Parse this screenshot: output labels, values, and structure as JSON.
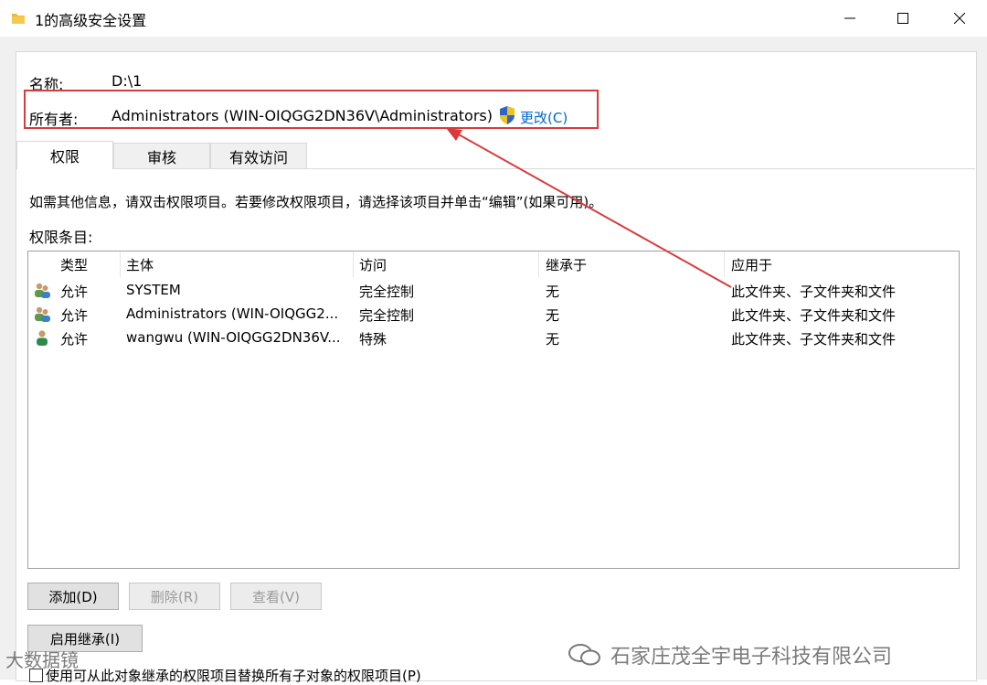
{
  "window": {
    "title": "1的高级安全设置",
    "minimize": "—",
    "maximize": "☐",
    "close": "✕"
  },
  "info": {
    "name_label": "名称:",
    "name_value": "D:\\1",
    "owner_label": "所有者:",
    "owner_value": "Administrators (WIN-OIQGG2DN36V\\Administrators)",
    "change_link": "更改(C)"
  },
  "tabs": [
    {
      "label": "权限",
      "active": true
    },
    {
      "label": "审核",
      "active": false
    },
    {
      "label": "有效访问",
      "active": false
    }
  ],
  "hint_text": "如需其他信息，请双击权限项目。若要修改权限项目，请选择该项目并单击“编辑”(如果可用)。",
  "entries_label": "权限条目:",
  "table": {
    "columns": [
      "类型",
      "主体",
      "访问",
      "继承于",
      "应用于"
    ],
    "rows": [
      {
        "icon": "group-users-icon",
        "type": "允许",
        "principal": "SYSTEM",
        "access": "完全控制",
        "inherited": "无",
        "applies": "此文件夹、子文件夹和文件"
      },
      {
        "icon": "group-users-icon",
        "type": "允许",
        "principal": "Administrators (WIN-OIQGG2...",
        "access": "完全控制",
        "inherited": "无",
        "applies": "此文件夹、子文件夹和文件"
      },
      {
        "icon": "single-user-icon",
        "type": "允许",
        "principal": "wangwu (WIN-OIQGG2DN36V...",
        "access": "特殊",
        "inherited": "无",
        "applies": "此文件夹、子文件夹和文件"
      }
    ]
  },
  "buttons": {
    "add": "添加(D)",
    "remove": "删除(R)",
    "view": "查看(V)",
    "enable_inheritance": "启用继承(I)"
  },
  "checkbox_label": "使用可从此对象继承的权限项目替换所有子对象的权限项目(P)",
  "watermarks": {
    "left": "大数据镜",
    "right": "石家庄茂全宇电子科技有限公司"
  },
  "colors": {
    "highlight_box": "#d83b3b",
    "link": "#0066cc",
    "folder": "#e8b93c"
  }
}
